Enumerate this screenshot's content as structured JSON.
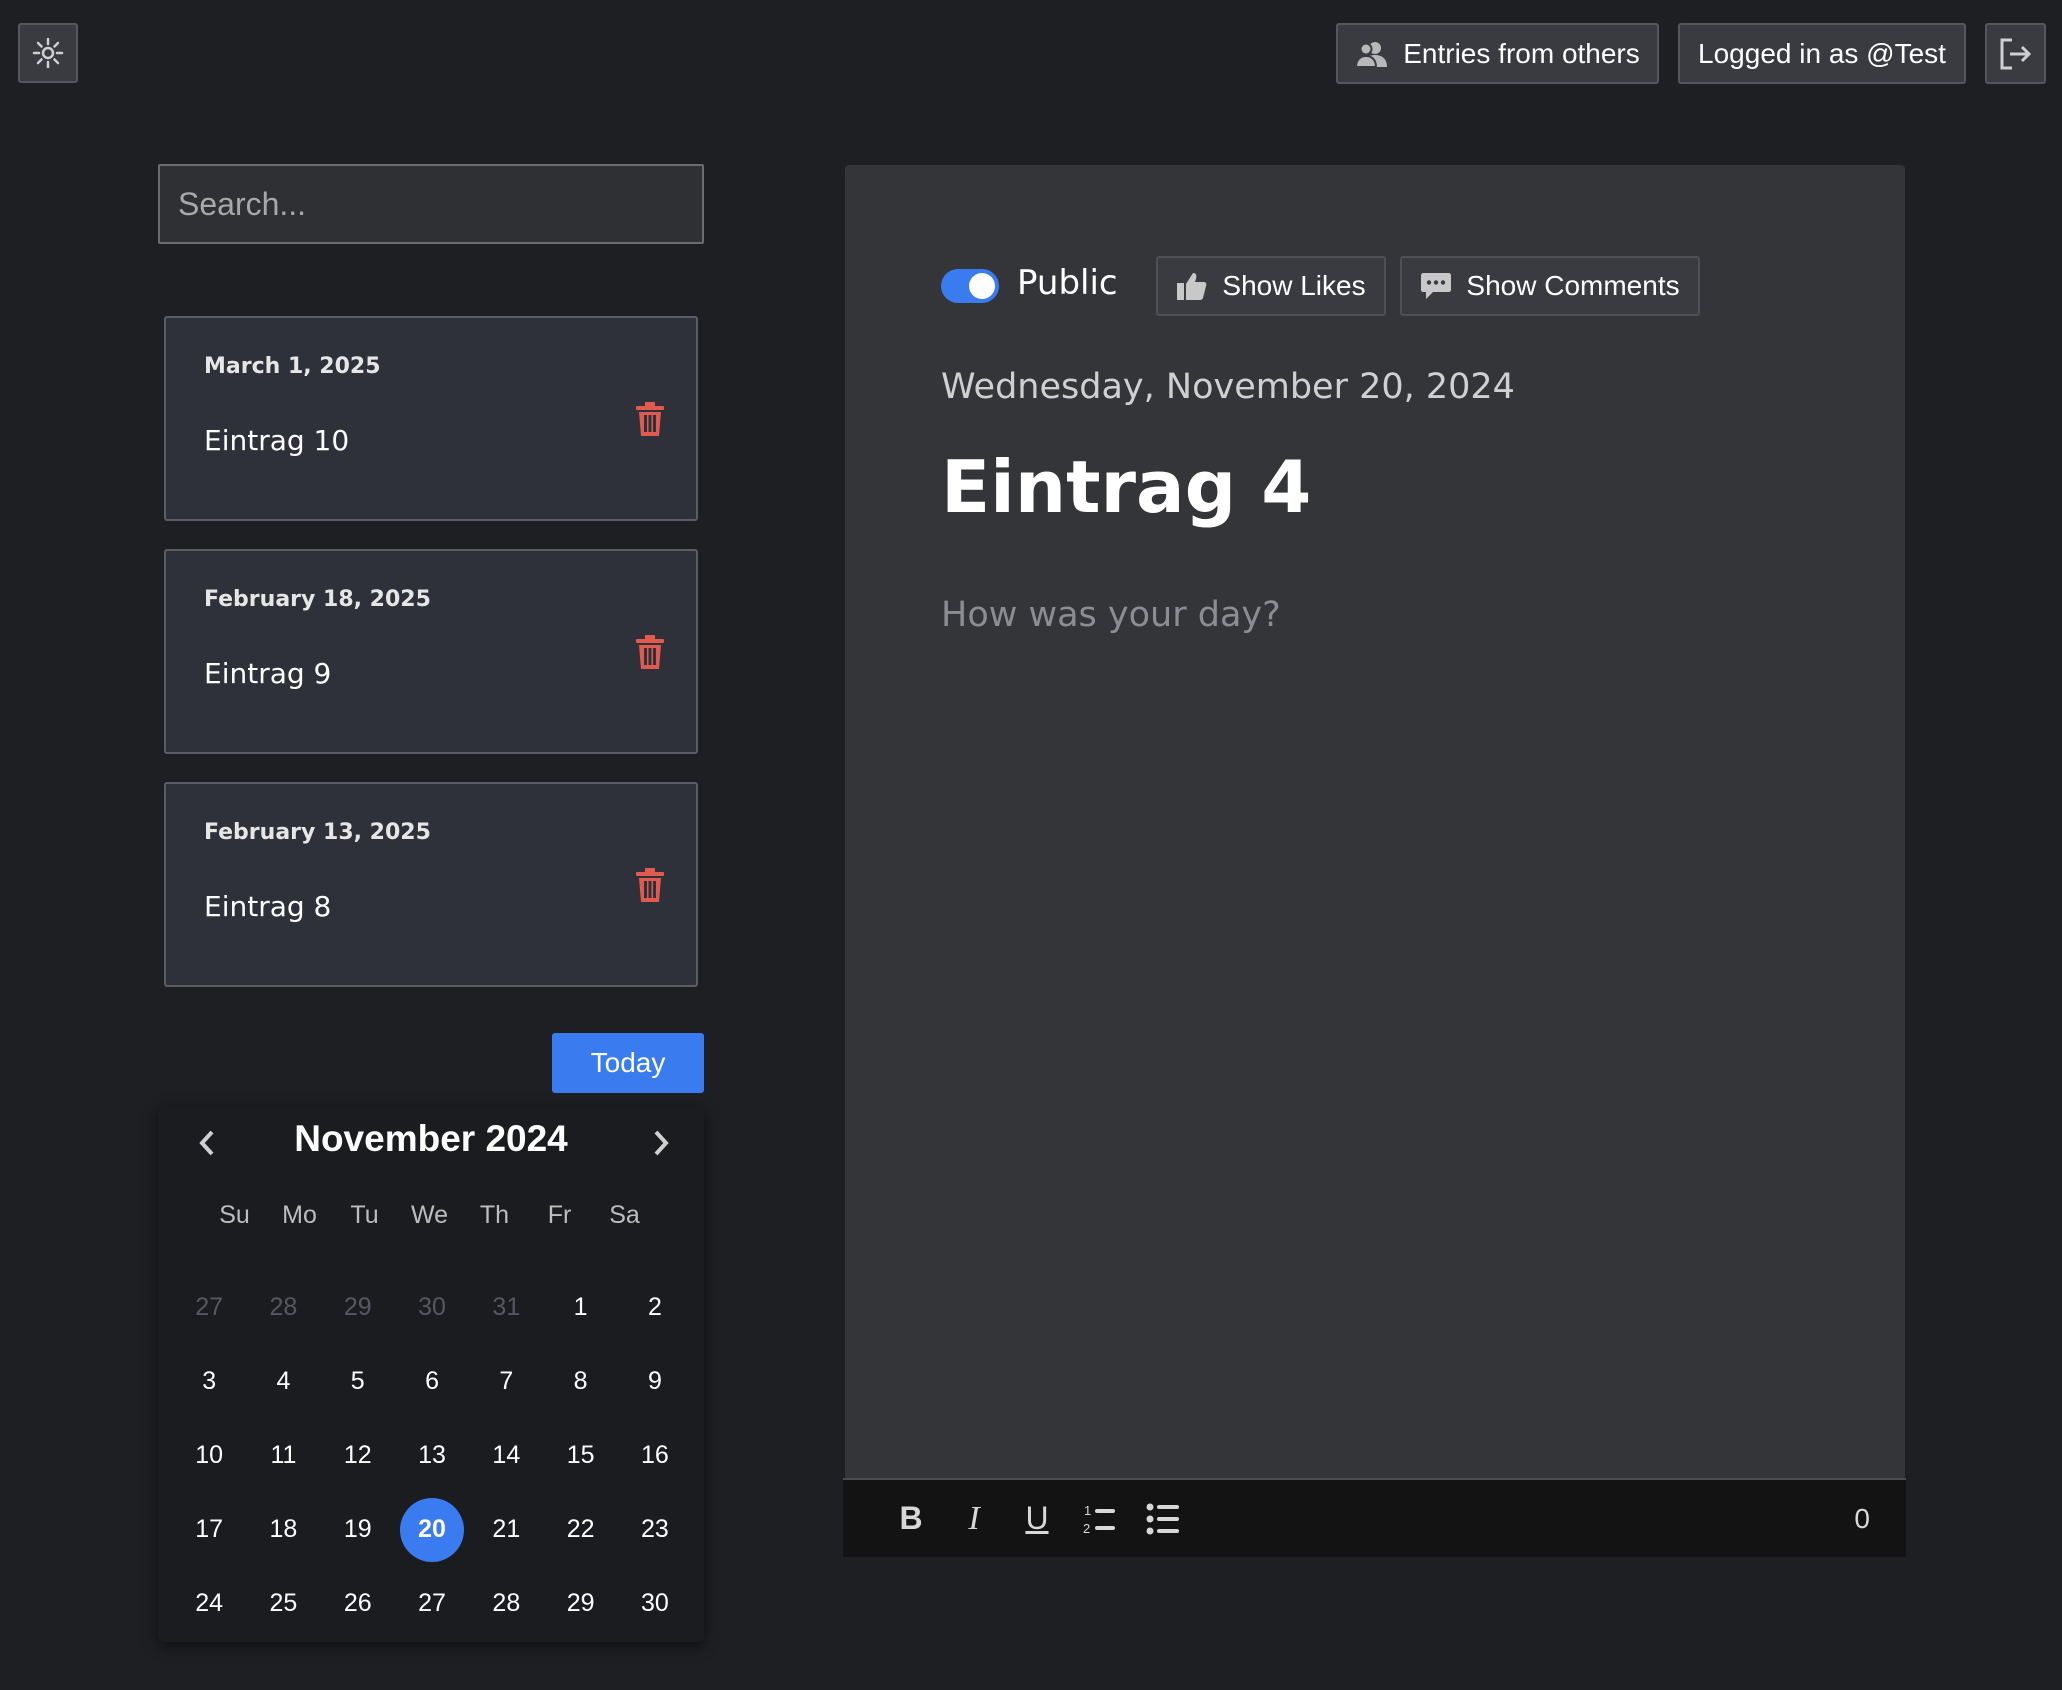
{
  "header": {
    "settings_icon": "sun-gear-icon",
    "entries_from_others_label": "Entries from others",
    "logged_in_label": "Logged in as @Test",
    "logout_icon": "logout-icon"
  },
  "search": {
    "placeholder": "Search..."
  },
  "entries": [
    {
      "date": "March 1, 2025",
      "title": "Eintrag 10"
    },
    {
      "date": "February 18, 2025",
      "title": "Eintrag 9"
    },
    {
      "date": "February 13, 2025",
      "title": "Eintrag 8"
    }
  ],
  "today_label": "Today",
  "calendar": {
    "month_label": "November 2024",
    "weekdays": [
      "Su",
      "Mo",
      "Tu",
      "We",
      "Th",
      "Fr",
      "Sa"
    ],
    "days": [
      [
        "27",
        "28",
        "29",
        "30",
        "31",
        "1",
        "2"
      ],
      [
        "3",
        "4",
        "5",
        "6",
        "7",
        "8",
        "9"
      ],
      [
        "10",
        "11",
        "12",
        "13",
        "14",
        "15",
        "16"
      ],
      [
        "17",
        "18",
        "19",
        "20",
        "21",
        "22",
        "23"
      ],
      [
        "24",
        "25",
        "26",
        "27",
        "28",
        "29",
        "30"
      ]
    ],
    "leading_muted_count": 5,
    "selected_day": "20"
  },
  "editor": {
    "public_label": "Public",
    "public_enabled": true,
    "show_likes_label": "Show Likes",
    "show_comments_label": "Show Comments",
    "date_heading": "Wednesday, November 20, 2024",
    "title": "Eintrag 4",
    "body_placeholder": "How was your day?",
    "char_count": "0",
    "toolbar_icons": [
      "bold-icon",
      "italic-icon",
      "underline-icon",
      "ordered-list-icon",
      "bullet-list-icon"
    ]
  },
  "colors": {
    "background": "#1e1f22",
    "accent": "#3a7cf0",
    "danger": "#e05a4f",
    "card": "#2e3139",
    "editor": "#343538"
  }
}
